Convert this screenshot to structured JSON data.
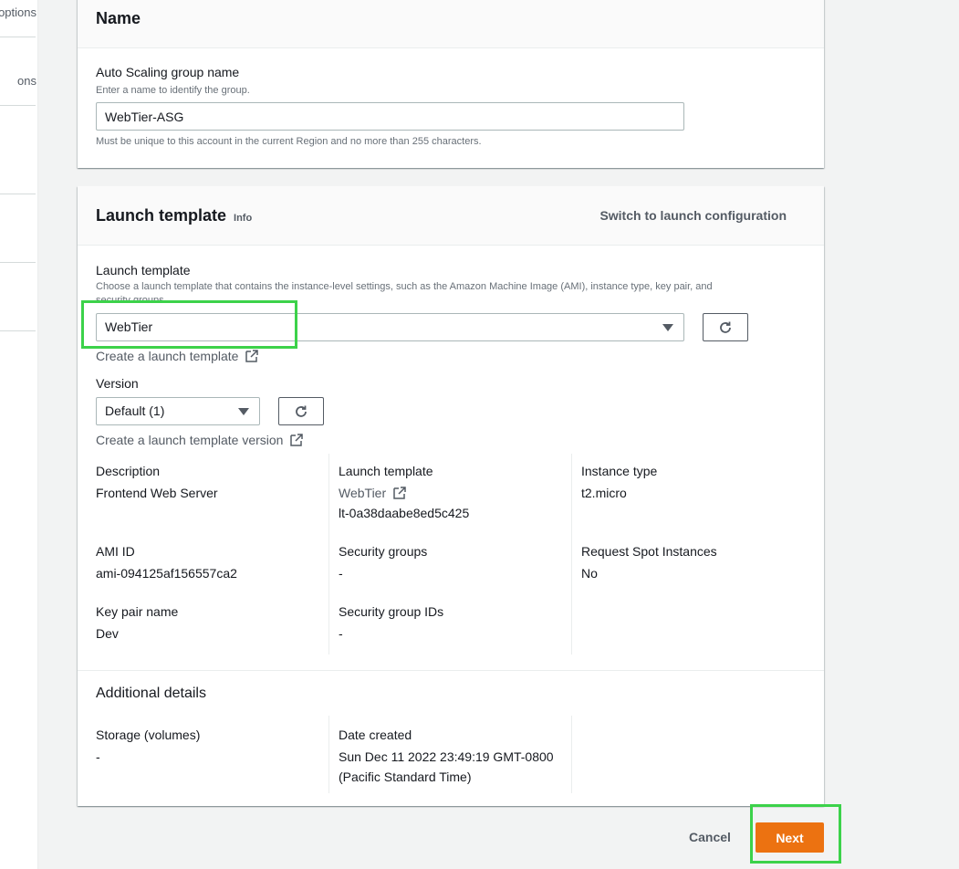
{
  "left_nav": {
    "fragments": [
      "options",
      "ons"
    ]
  },
  "name_section": {
    "title": "Name",
    "asg_label": "Auto Scaling group name",
    "asg_desc": "Enter a name to identify the group.",
    "asg_value": "WebTier-ASG",
    "asg_constraint": "Must be unique to this account in the current Region and no more than 255 characters."
  },
  "launch_section": {
    "title": "Launch template",
    "info": "Info",
    "switch_link": "Switch to launch configuration",
    "lt_label": "Launch template",
    "lt_desc_line1": "Choose a launch template that contains the instance-level settings, such as the Amazon Machine Image (AMI), instance type, key pair, and",
    "lt_desc_line2": "security groups.",
    "lt_selected": "WebTier",
    "create_lt_link": "Create a launch template",
    "version_label": "Version",
    "version_selected": "Default (1)",
    "create_version_link": "Create a launch template version",
    "details": {
      "description_label": "Description",
      "description_value": "Frontend Web Server",
      "lt_label": "Launch template",
      "lt_link": "WebTier",
      "lt_id": "lt-0a38daabe8ed5c425",
      "instance_type_label": "Instance type",
      "instance_type_value": "t2.micro",
      "ami_label": "AMI ID",
      "ami_value": "ami-094125af156557ca2",
      "sg_label": "Security groups",
      "sg_value": "-",
      "spot_label": "Request Spot Instances",
      "spot_value": "No",
      "keypair_label": "Key pair name",
      "keypair_value": "Dev",
      "sg_ids_label": "Security group IDs",
      "sg_ids_value": "-"
    },
    "additional": {
      "title": "Additional details",
      "storage_label": "Storage (volumes)",
      "storage_value": "-",
      "date_label": "Date created",
      "date_value_line1": "Sun Dec 11 2022 23:49:19 GMT-0800",
      "date_value_line2": "(Pacific Standard Time)"
    }
  },
  "footer": {
    "cancel": "Cancel",
    "next": "Next"
  },
  "colors": {
    "accent": "#ec7211",
    "highlight": "#3cd24a"
  }
}
